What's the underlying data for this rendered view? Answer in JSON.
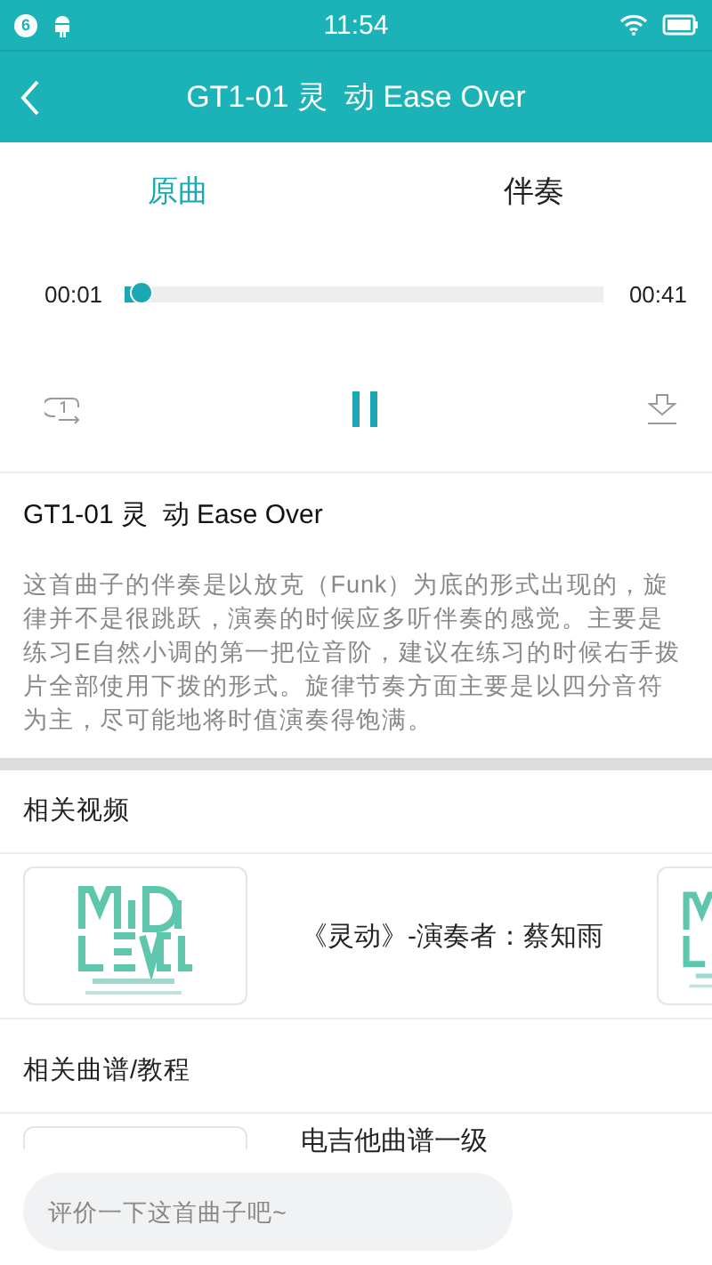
{
  "status_bar": {
    "badge": "6",
    "time": "11:54"
  },
  "nav": {
    "title": "GT1-01 灵  动 Ease Over"
  },
  "tabs": [
    {
      "label": "原曲",
      "selected": true
    },
    {
      "label": "伴奏",
      "selected": false
    }
  ],
  "player": {
    "elapsed": "00:01",
    "total": "00:41",
    "level": 0.04,
    "playing": true
  },
  "song": {
    "title": "GT1-01 灵  动 Ease Over",
    "description": "这首曲子的伴奏是以放克（Funk）为底的形式出现的，旋律并不是很跳跃，演奏的时候应多听伴奏的感觉。主要是练习E自然小调的第一把位音阶，建议在练习的时候右手拨片全部使用下拨的形式。旋律节奏方面主要是以四分音符为主，尽可能地将时值演奏得饱满。"
  },
  "related_videos": {
    "heading": "相关视频",
    "items": [
      {
        "title": "《灵动》-演奏者：蔡知雨"
      }
    ]
  },
  "related_scores": {
    "heading": "相关曲谱/教程",
    "items": [
      {
        "title": "电吉他曲谱一级"
      }
    ]
  },
  "comment": {
    "placeholder": "评价一下这首曲子吧~"
  }
}
